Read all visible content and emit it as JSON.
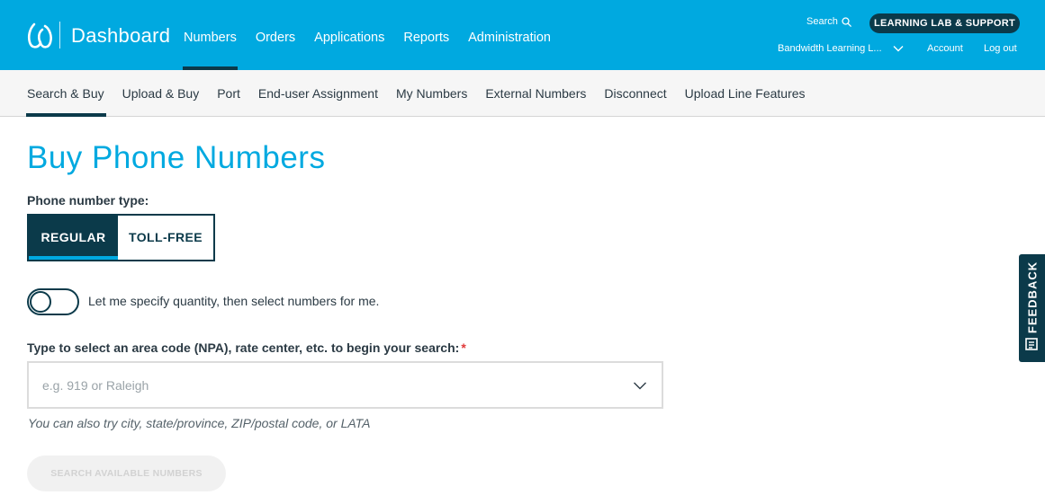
{
  "header": {
    "brand": "Dashboard",
    "nav": [
      {
        "label": "Numbers",
        "active": true
      },
      {
        "label": "Orders"
      },
      {
        "label": "Applications"
      },
      {
        "label": "Reports"
      },
      {
        "label": "Administration"
      }
    ],
    "search_label": "Search",
    "learning_button": "LEARNING LAB & SUPPORT",
    "account_selector": "Bandwidth Learning L...",
    "account_link": "Account",
    "logout_link": "Log out"
  },
  "subnav": [
    {
      "label": "Search & Buy",
      "active": true
    },
    {
      "label": "Upload & Buy"
    },
    {
      "label": "Port"
    },
    {
      "label": "End-user Assignment"
    },
    {
      "label": "My Numbers"
    },
    {
      "label": "External Numbers"
    },
    {
      "label": "Disconnect"
    },
    {
      "label": "Upload Line Features"
    }
  ],
  "page": {
    "title": "Buy Phone Numbers",
    "type_label": "Phone number type:",
    "type_options": [
      "REGULAR",
      "TOLL-FREE"
    ],
    "selected_type": "REGULAR",
    "quantity_toggle_label": "Let me specify quantity, then select numbers for me.",
    "quantity_toggle_on": false,
    "search_label": "Type to select an area code (NPA), rate center, etc. to begin your search:",
    "required_mark": "*",
    "search_placeholder": "e.g. 919 or Raleigh",
    "search_value": "",
    "hint": "You can also try city, state/province, ZIP/postal code, or LATA",
    "search_button": "SEARCH AVAILABLE NUMBERS",
    "search_button_disabled": true
  },
  "feedback": {
    "label": "FEEDBACK"
  },
  "colors": {
    "brand_blue": "#00a9e0",
    "navy": "#0b3a4a",
    "required": "#e03a3a",
    "subnav_bg": "#f6f6f6"
  },
  "icons": [
    "bandwidth-logo-icon",
    "search-icon",
    "chevron-down-icon",
    "feedback-icon"
  ]
}
